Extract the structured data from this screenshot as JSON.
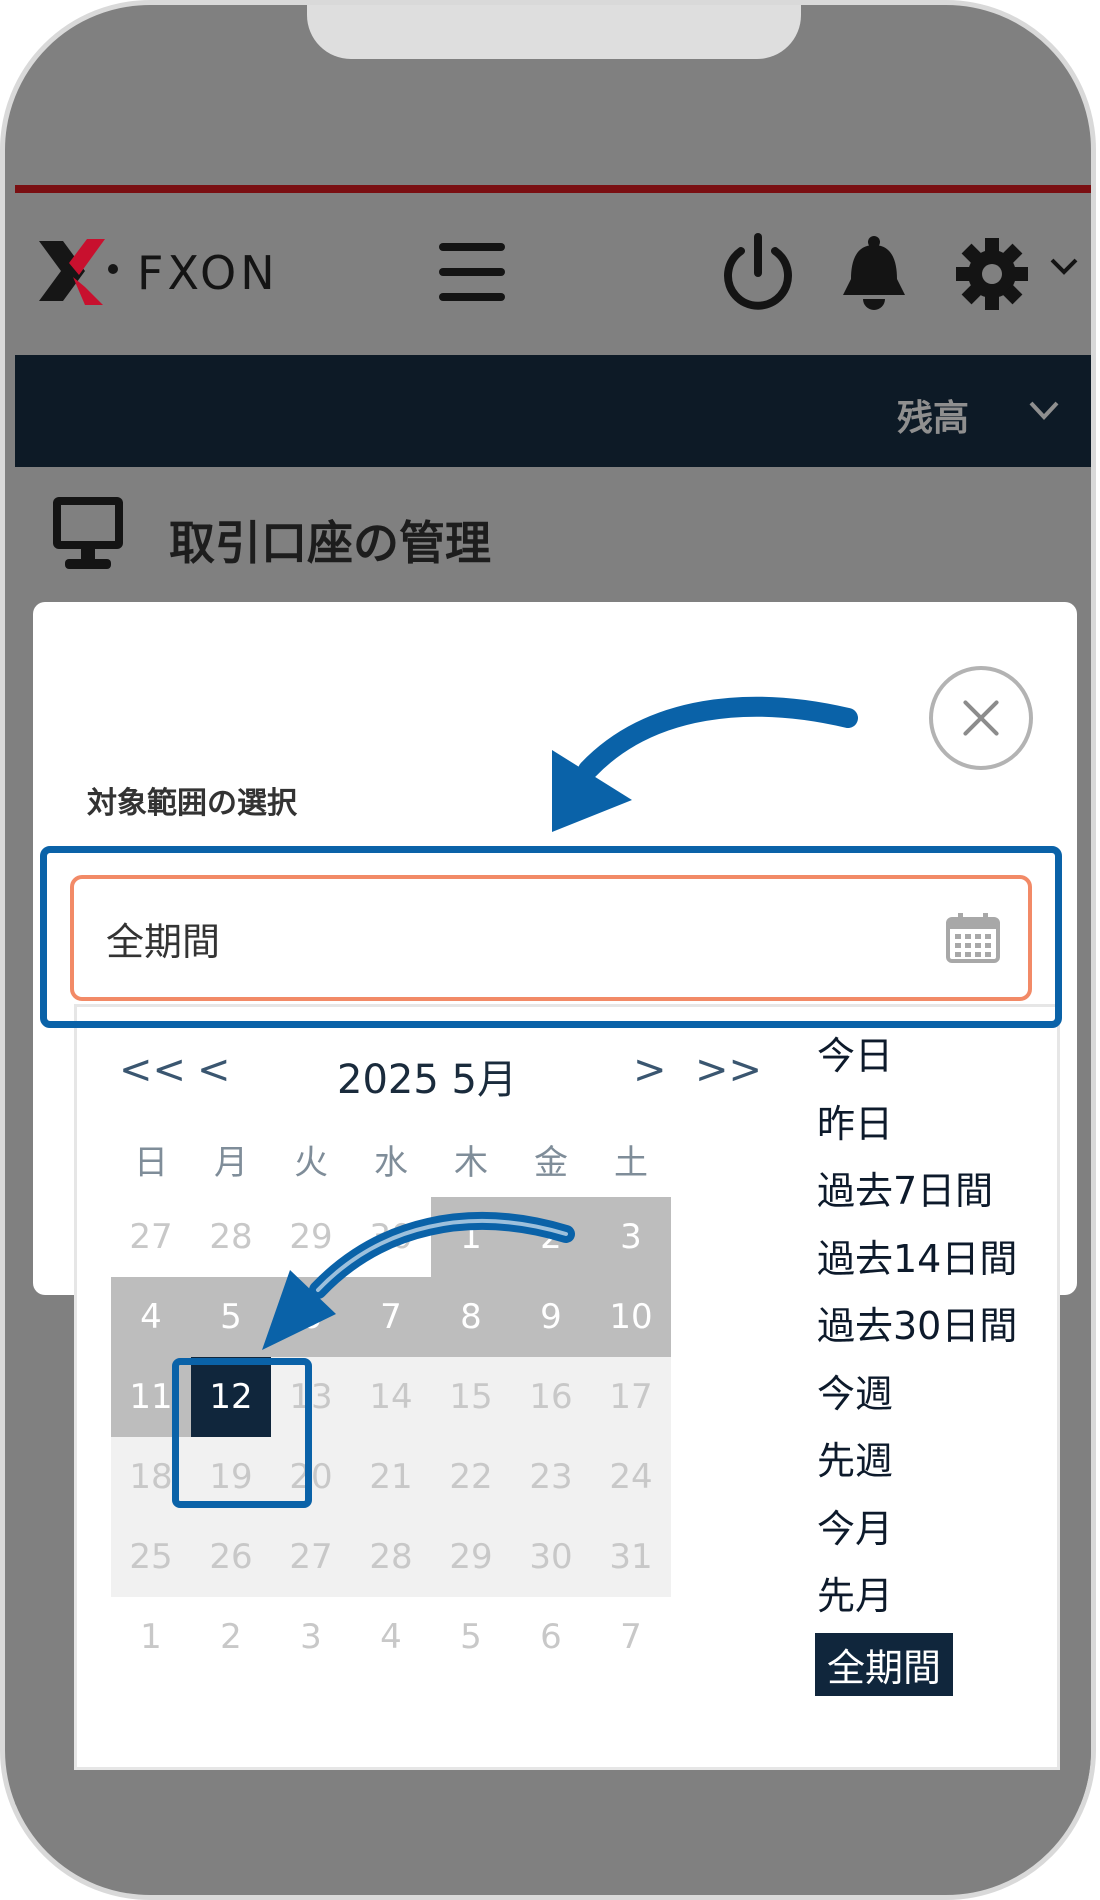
{
  "header": {
    "logo_text": "FXON",
    "icons": [
      "menu-icon",
      "power-icon",
      "bell-icon",
      "gear-icon",
      "chevron-down-icon"
    ]
  },
  "navbar": {
    "balance_label": "残高"
  },
  "page": {
    "title": "取引口座の管理"
  },
  "modal": {
    "range_label": "対象範囲の選択",
    "input_value": "全期間"
  },
  "calendar": {
    "nav": {
      "prev_year": "<<",
      "prev_month": "<",
      "next_month": ">",
      "next_year": ">>"
    },
    "month_label": "2025  5月",
    "weekdays": [
      "日",
      "月",
      "火",
      "水",
      "木",
      "金",
      "土"
    ],
    "weeks": [
      [
        "27",
        "28",
        "29",
        "30",
        "1",
        "2",
        "3"
      ],
      [
        "4",
        "5",
        "6",
        "7",
        "8",
        "9",
        "10"
      ],
      [
        "11",
        "12",
        "13",
        "14",
        "15",
        "16",
        "17"
      ],
      [
        "18",
        "19",
        "20",
        "21",
        "22",
        "23",
        "24"
      ],
      [
        "25",
        "26",
        "27",
        "28",
        "29",
        "30",
        "31"
      ],
      [
        "1",
        "2",
        "3",
        "4",
        "5",
        "6",
        "7"
      ]
    ],
    "selected_day": "12"
  },
  "presets": [
    "今日",
    "昨日",
    "過去7日間",
    "過去14日間",
    "過去30日間",
    "今週",
    "先週",
    "今月",
    "先月",
    "全期間"
  ],
  "active_preset": "全期間",
  "colors": {
    "navbar": "#0d1a26",
    "highlight": "#0a62a8",
    "input_border": "#f28a67",
    "selected": "#10263c",
    "range": "#bdbdbd"
  }
}
